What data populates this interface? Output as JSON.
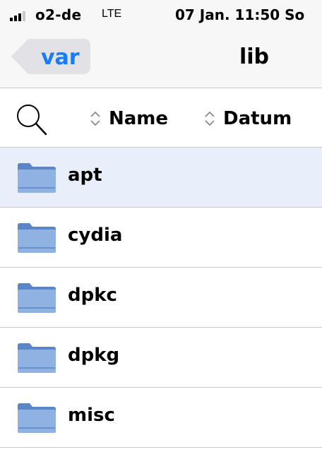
{
  "status": {
    "carrier": "o2-de",
    "network": "LTE",
    "time": "07 Jan. 11:50 So"
  },
  "nav": {
    "back_label": "var",
    "title": "lib"
  },
  "toolbar": {
    "sort_name_label": "Name",
    "sort_date_label": "Datum"
  },
  "files": [
    {
      "name": "apt",
      "selected": true
    },
    {
      "name": "cydia",
      "selected": false
    },
    {
      "name": "dpkc",
      "selected": false
    },
    {
      "name": "dpkg",
      "selected": false
    },
    {
      "name": "misc",
      "selected": false
    }
  ],
  "colors": {
    "accent": "#1a7cf5",
    "folder": "#8fb2e3",
    "folder_tab": "#5a86c8",
    "selected_row": "#e8eefa"
  }
}
